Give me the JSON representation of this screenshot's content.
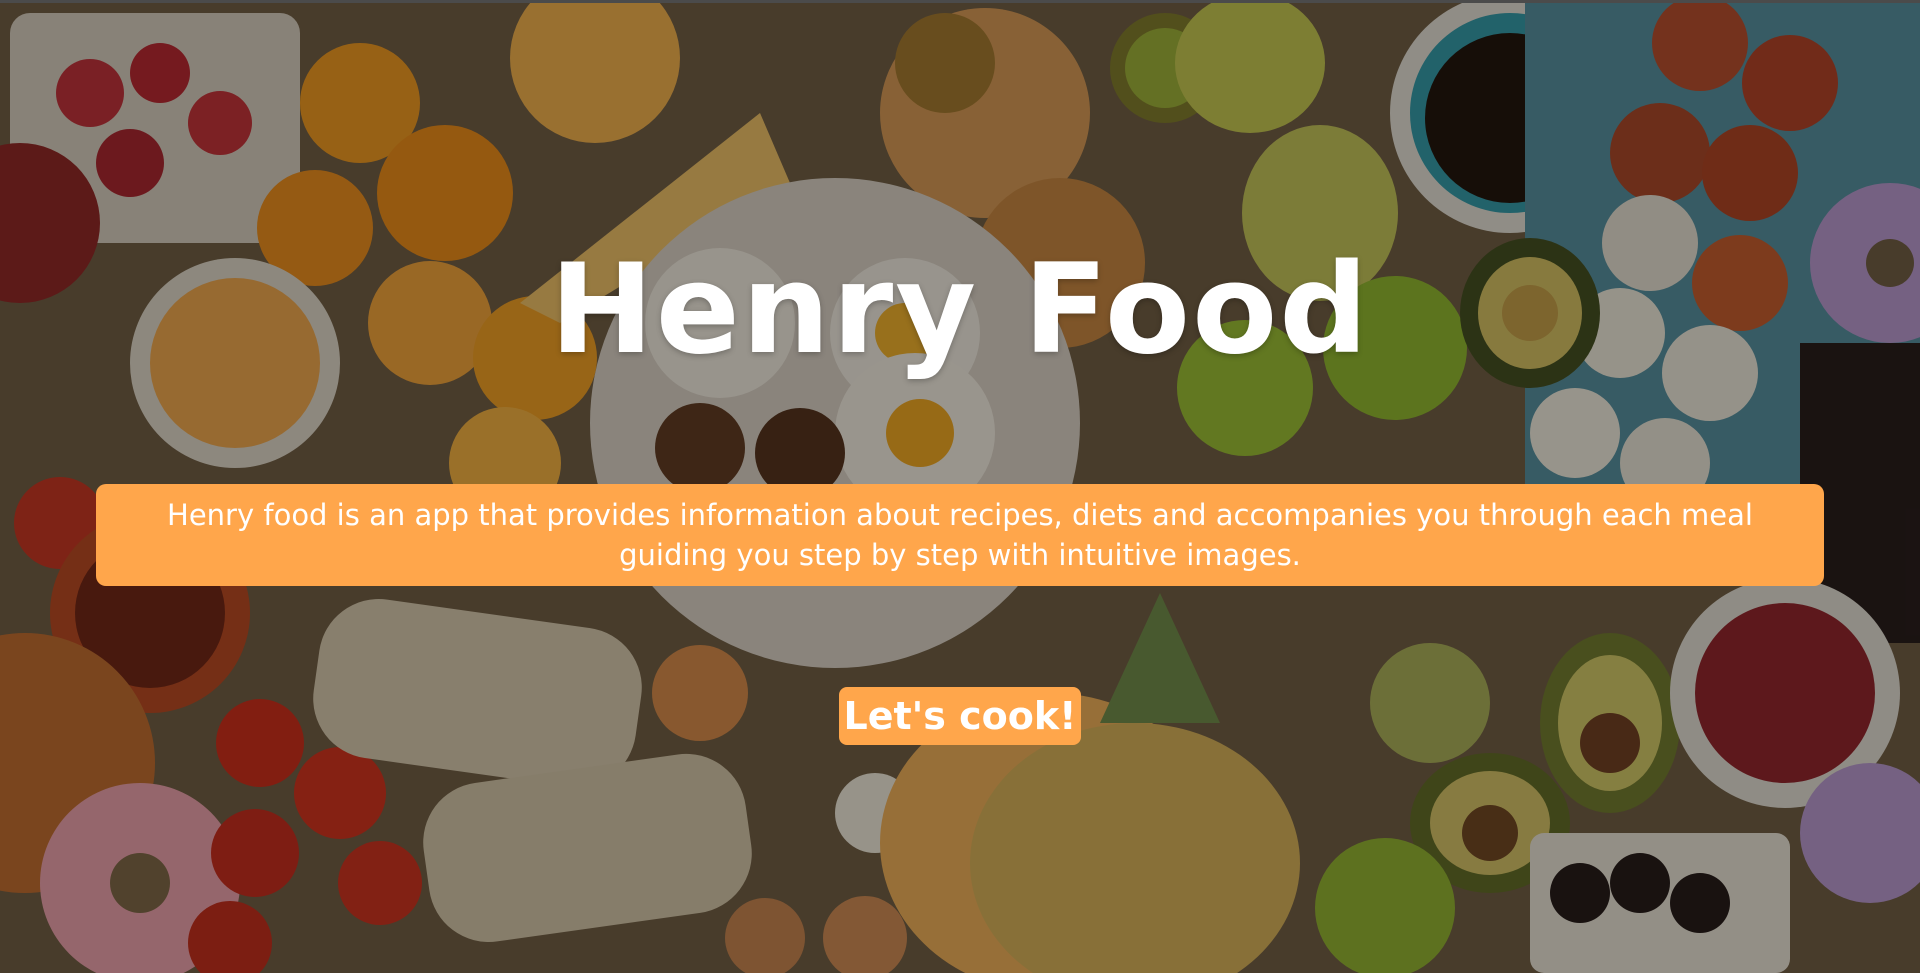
{
  "hero": {
    "title": "Henry Food",
    "description": "Henry food is an app that provides information about recipes, diets and accompanies you through each meal guiding you step by step with intuitive images.",
    "cta_label": "Let's cook!"
  },
  "colors": {
    "accent": "#ffa64b",
    "text": "#ffffff",
    "overlay": "#19120a"
  },
  "background_image": "food-flatlay-photo"
}
